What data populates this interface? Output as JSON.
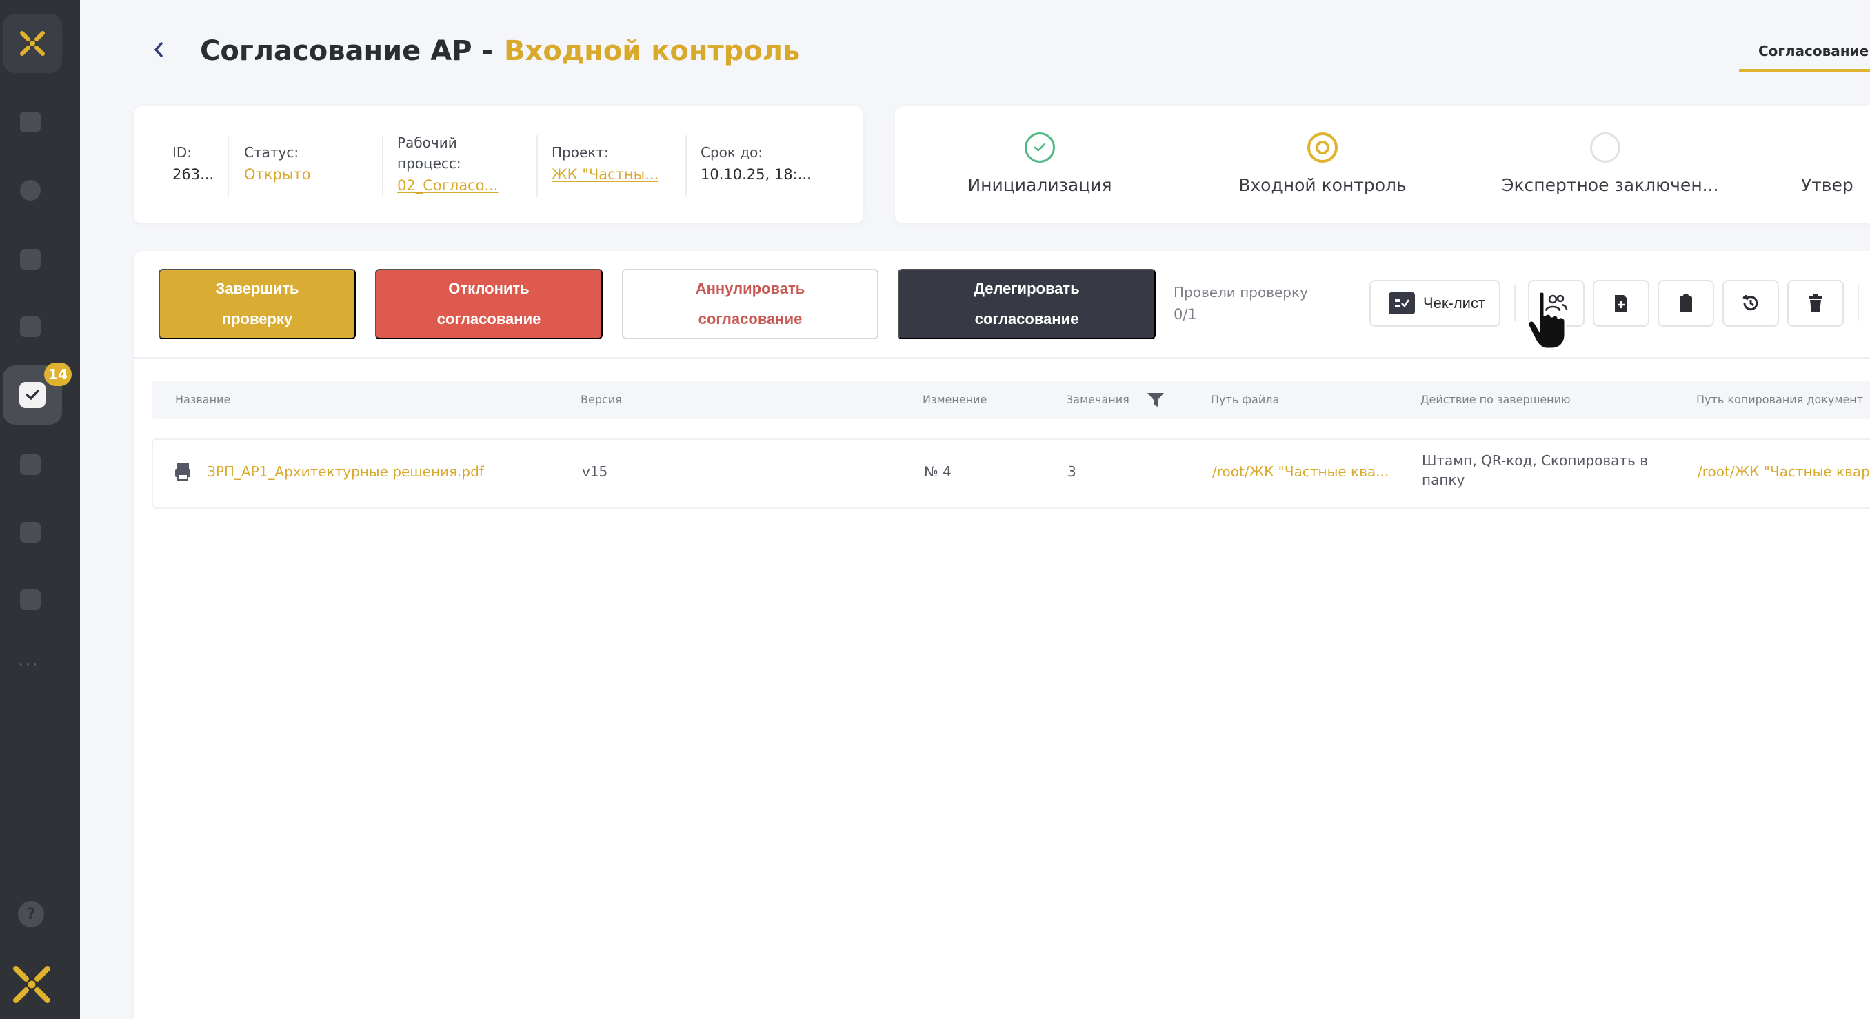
{
  "sidebar": {
    "badge_count": "14",
    "more_label": "···",
    "help_label": "?"
  },
  "header": {
    "title": "Согласование АР -",
    "title_accent": "Входной контроль",
    "right_tab": "Согласование"
  },
  "info": {
    "id_label": "ID:",
    "id_value": "263...",
    "status_label": "Статус:",
    "status_value": "Открыто",
    "workflow_label_1": "Рабочий",
    "workflow_label_2": "процесс:",
    "workflow_value": "02_Согласо...",
    "project_label": "Проект:",
    "project_value": "ЖК \"Частны...",
    "deadline_label": "Срок до:",
    "deadline_value": "10.10.25, 18:..."
  },
  "steps": [
    {
      "label": "Инициализация",
      "state": "done"
    },
    {
      "label": "Входной контроль",
      "state": "current"
    },
    {
      "label": "Экспертное заключен...",
      "state": "pending"
    },
    {
      "label": "Утвер",
      "state": "pending"
    }
  ],
  "actions": {
    "finish_1": "Завершить",
    "finish_2": "проверку",
    "reject_1": "Отклонить",
    "reject_2": "согласование",
    "annul_1": "Аннулировать",
    "annul_2": "согласование",
    "delegate_1": "Делегировать",
    "delegate_2": "согласование",
    "progress_label": "Провели проверку",
    "progress_value": "0/1",
    "checklist_label": "Чек-лист"
  },
  "table": {
    "headers": {
      "name": "Название",
      "version": "Версия",
      "change": "Изменение",
      "remarks": "Замечания",
      "file_path": "Путь файла",
      "action": "Действие по завершению",
      "copy_path": "Путь копирования документ"
    },
    "rows": [
      {
        "name": "ЗРП_АР1_Архитектурные решения.pdf",
        "version": "v15",
        "change": "№ 4",
        "remarks": "3",
        "file_path": "/root/ЖК \"Частные ква...",
        "action_1": "Штамп, QR-код, Скопировать в",
        "action_2": "папку",
        "copy_path": "/root/ЖК \"Частные квар"
      }
    ]
  },
  "colors": {
    "accent": "#d9ac33",
    "danger": "#de5a4f",
    "dark": "#373a45",
    "sidebar": "#2f3237",
    "success": "#4cb884"
  }
}
